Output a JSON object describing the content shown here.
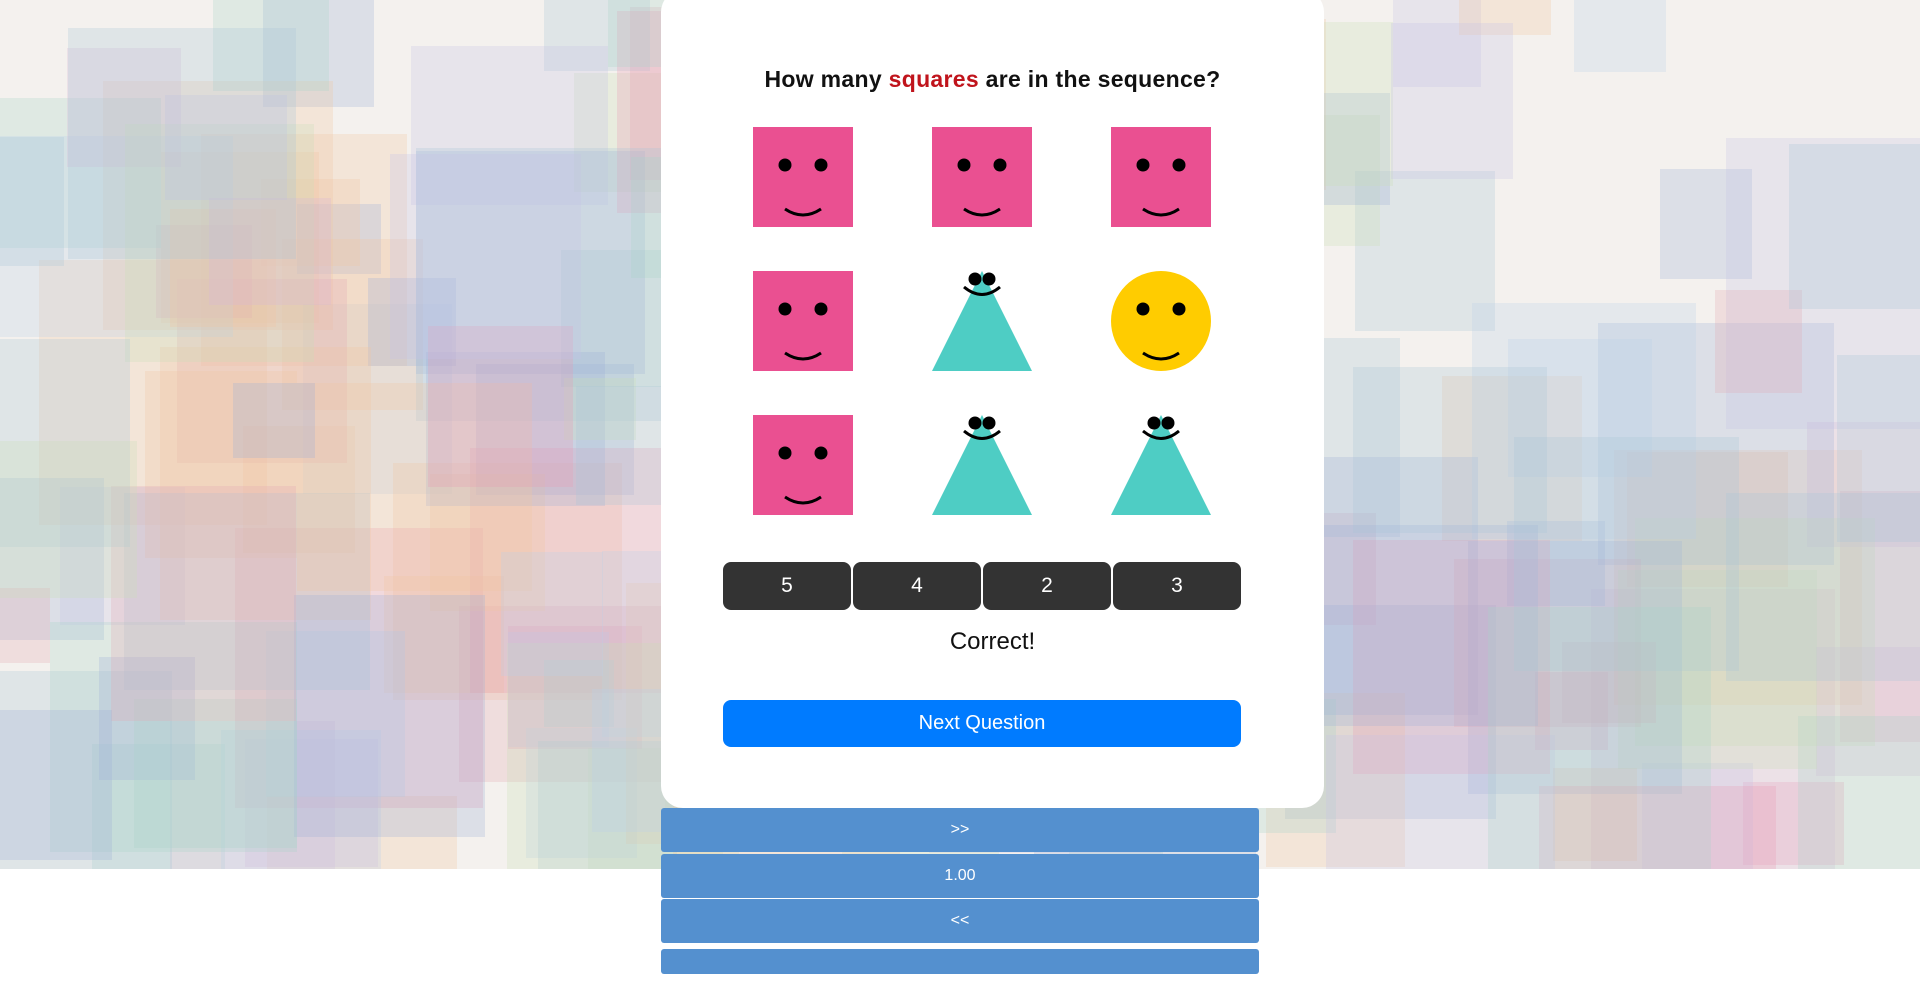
{
  "question": {
    "prefix": "How many",
    "highlight": "squares",
    "suffix": "are in the sequence?"
  },
  "shapes": [
    {
      "type": "square",
      "color": "#ea5091"
    },
    {
      "type": "square",
      "color": "#ea5091"
    },
    {
      "type": "square",
      "color": "#ea5091"
    },
    {
      "type": "square",
      "color": "#ea5091"
    },
    {
      "type": "triangle",
      "color": "#4ecdc4"
    },
    {
      "type": "circle",
      "color": "#ffcc00"
    },
    {
      "type": "square",
      "color": "#ea5091"
    },
    {
      "type": "triangle",
      "color": "#4ecdc4"
    },
    {
      "type": "triangle",
      "color": "#4ecdc4"
    }
  ],
  "answers": [
    "5",
    "4",
    "2",
    "3"
  ],
  "feedback": "Correct!",
  "next_button": "Next Question",
  "controls": {
    "forward": ">>",
    "speed": "1.00",
    "back": "<<",
    "extra": ""
  },
  "colors": {
    "answer_bg": "#333333",
    "primary": "#007bff",
    "control_bg": "#5490cf",
    "highlight": "#c0141c"
  }
}
